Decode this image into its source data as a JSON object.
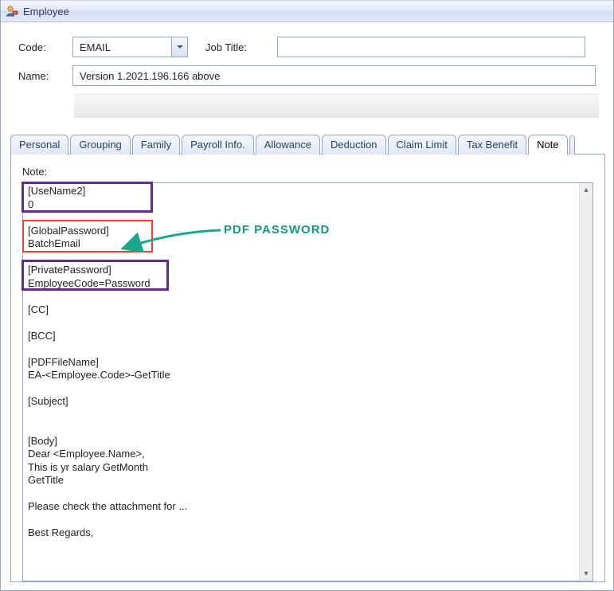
{
  "window": {
    "title": "Employee"
  },
  "form": {
    "code_label": "Code:",
    "code_value": "EMAIL",
    "jobtitle_label": "Job Title:",
    "jobtitle_value": "",
    "name_label": "Name:",
    "name_value": "Version 1.2021.196.166   above"
  },
  "tabs": [
    "Personal",
    "Grouping",
    "Family",
    "Payroll Info.",
    "Allowance",
    "Deduction",
    "Claim Limit",
    "Tax Benefit",
    "Note"
  ],
  "active_tab": "Note",
  "note": {
    "label": "Note:",
    "lines": [
      "[UseName2]",
      "0",
      "",
      "[GlobalPassword]",
      "BatchEmail",
      "",
      "[PrivatePassword]",
      "EmployeeCode=Password",
      "",
      "[CC]",
      "",
      "[BCC]",
      "",
      "[PDFFileName]",
      "EA-<Employee.Code>-GetTitle",
      "",
      "[Subject]",
      "",
      "",
      "[Body]",
      "Dear <Employee.Name>,",
      "This is yr salary GetMonth",
      "GetTitle",
      "",
      "Please check the attachment for ...",
      "",
      "Best Regards,"
    ]
  },
  "annotation": {
    "label": "PDF PASSWORD",
    "arrow_color": "#1aa68a"
  }
}
